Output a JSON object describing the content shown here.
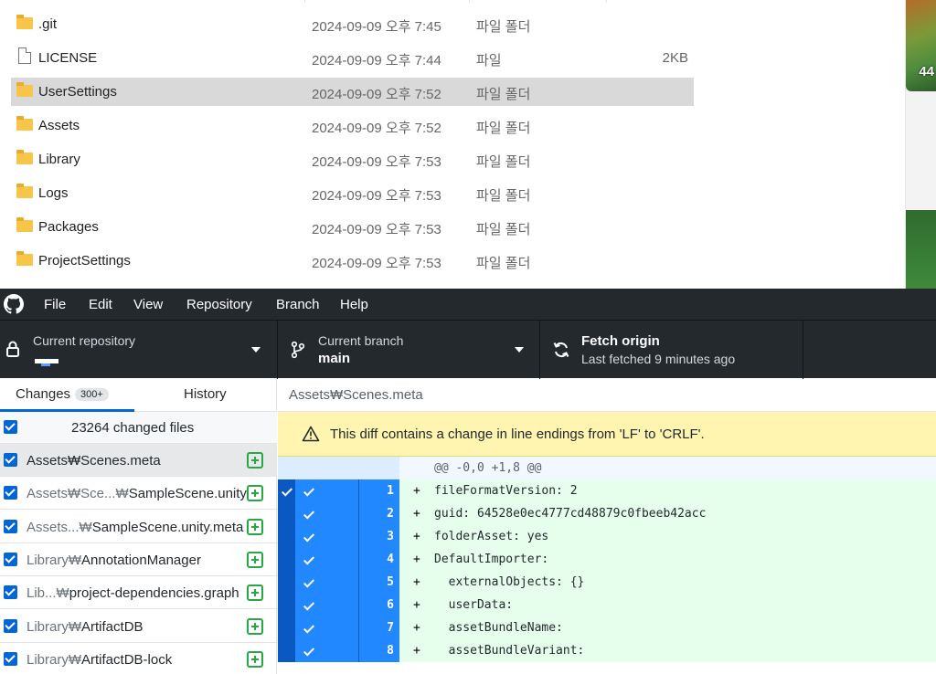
{
  "explorer": {
    "files": [
      {
        "name": ".git",
        "date": "2024-09-09 오후 7:45",
        "type": "파일 폴더",
        "size": "",
        "icon": "folder-icon"
      },
      {
        "name": "LICENSE",
        "date": "2024-09-09 오후 7:44",
        "type": "파일",
        "size": "2KB",
        "icon": "file-icon"
      },
      {
        "name": "UserSettings",
        "date": "2024-09-09 오후 7:52",
        "type": "파일 폴더",
        "size": "",
        "icon": "folder-icon",
        "selected": true
      },
      {
        "name": "Assets",
        "date": "2024-09-09 오후 7:52",
        "type": "파일 폴더",
        "size": "",
        "icon": "folder-icon"
      },
      {
        "name": "Library",
        "date": "2024-09-09 오후 7:53",
        "type": "파일 폴더",
        "size": "",
        "icon": "folder-icon"
      },
      {
        "name": "Logs",
        "date": "2024-09-09 오후 7:53",
        "type": "파일 폴더",
        "size": "",
        "icon": "folder-icon"
      },
      {
        "name": "Packages",
        "date": "2024-09-09 오후 7:53",
        "type": "파일 폴더",
        "size": "",
        "icon": "folder-icon"
      },
      {
        "name": "ProjectSettings",
        "date": "2024-09-09 오후 7:53",
        "type": "파일 폴더",
        "size": "",
        "icon": "folder-icon"
      }
    ],
    "side_badge": "44"
  },
  "menubar": {
    "items": [
      "File",
      "Edit",
      "View",
      "Repository",
      "Branch",
      "Help"
    ]
  },
  "toolbar": {
    "repository": {
      "label": "Current repository",
      "value": ""
    },
    "branch": {
      "label": "Current branch",
      "value": "main"
    },
    "fetch": {
      "title": "Fetch origin",
      "subtitle": "Last fetched 9 minutes ago"
    }
  },
  "sidebar": {
    "tabs": {
      "changes": "Changes",
      "changes_count": "300+",
      "history": "History"
    },
    "summary": "23264 changed files",
    "changes": [
      {
        "dir": "",
        "file": "Assets₩Scenes.meta",
        "active": true
      },
      {
        "dir": "Assets₩Sce...₩",
        "file": "SampleScene.unity"
      },
      {
        "dir": "Assets...₩",
        "file": "SampleScene.unity.meta"
      },
      {
        "dir": "Library₩",
        "file": "AnnotationManager"
      },
      {
        "dir": "Lib...₩",
        "file": "project-dependencies.graph"
      },
      {
        "dir": "Library₩",
        "file": "ArtifactDB"
      },
      {
        "dir": "Library₩",
        "file": "ArtifactDB-lock"
      }
    ]
  },
  "diff": {
    "path": "Assets₩Scenes.meta",
    "warning": "This diff contains a change in line endings from 'LF' to 'CRLF'.",
    "hunk": "@@ -0,0 +1,8 @@",
    "lines": [
      {
        "num": "1",
        "sign": "+",
        "code": "fileFormatVersion: 2"
      },
      {
        "num": "2",
        "sign": "+",
        "code": "guid: 64528e0ec4777cd48879c0fbeeb42acc"
      },
      {
        "num": "3",
        "sign": "+",
        "code": "folderAsset: yes"
      },
      {
        "num": "4",
        "sign": "+",
        "code": "DefaultImporter:"
      },
      {
        "num": "5",
        "sign": "+",
        "code": "  externalObjects: {}"
      },
      {
        "num": "6",
        "sign": "+",
        "code": "  userData:"
      },
      {
        "num": "7",
        "sign": "+",
        "code": "  assetBundleName:"
      },
      {
        "num": "8",
        "sign": "+",
        "code": "  assetBundleVariant:"
      }
    ]
  },
  "colors": {
    "accent": "#0366d6",
    "toolbar_bg": "#24292e",
    "added_bg": "#e6ffed",
    "warning_bg": "#fff5b1",
    "selection_blue": "#2188ff"
  }
}
